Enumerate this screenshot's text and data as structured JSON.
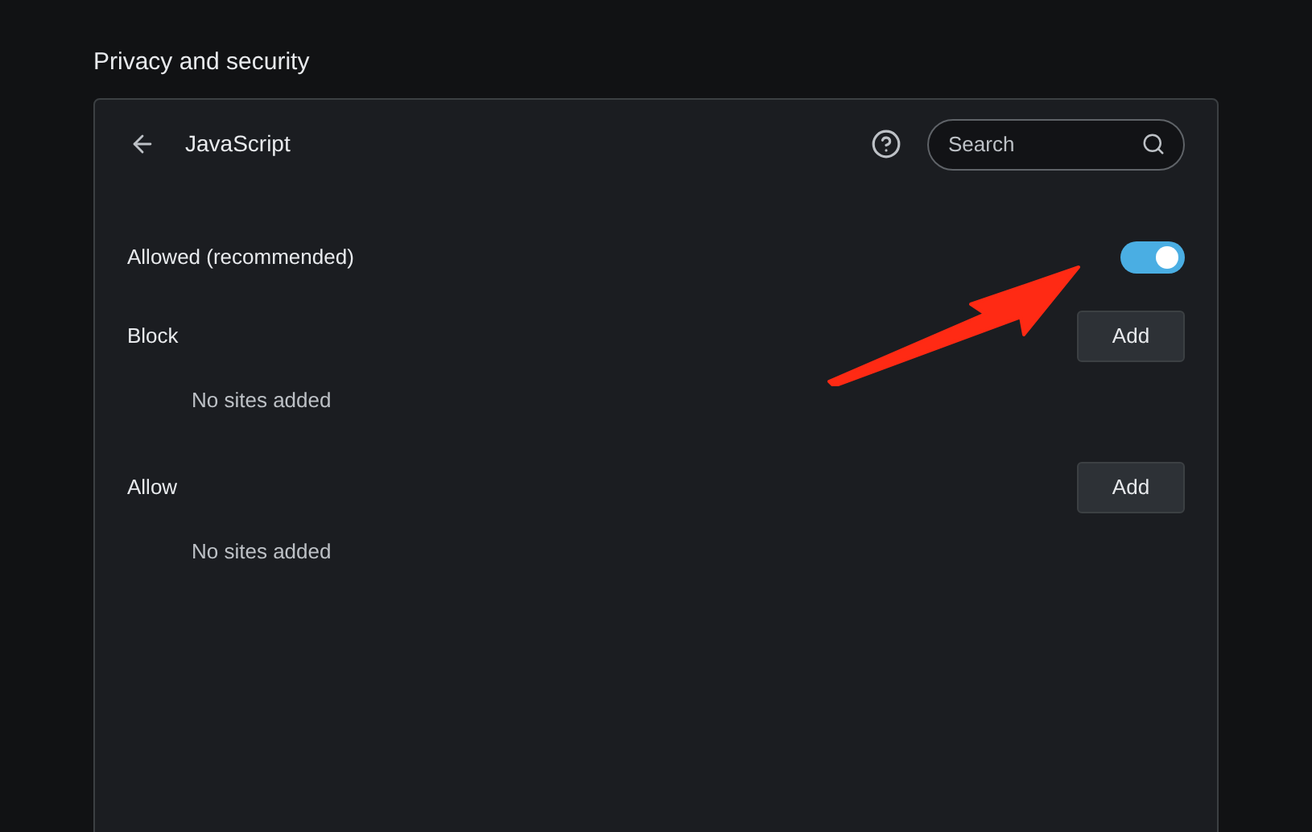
{
  "page_title": "Privacy and security",
  "header": {
    "title": "JavaScript",
    "search": {
      "placeholder": "Search"
    }
  },
  "default_setting": {
    "label": "Allowed (recommended)",
    "on": true
  },
  "sections": [
    {
      "title": "Block",
      "button": "Add",
      "empty_text": "No sites added"
    },
    {
      "title": "Allow",
      "button": "Add",
      "empty_text": "No sites added"
    }
  ]
}
